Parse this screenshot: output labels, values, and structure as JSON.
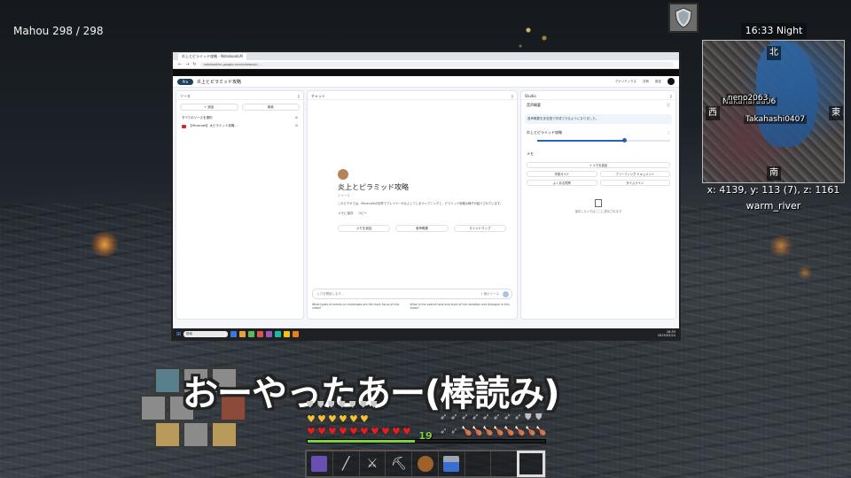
{
  "hud": {
    "player_health": "Mahou 298 / 298"
  },
  "minimap": {
    "time": "16:33 Night",
    "north": "北",
    "south": "南",
    "east": "東",
    "west": "西",
    "player1": "neno2063",
    "player1_hidden": "Nakaharaa06",
    "player2": "Takahashi0407",
    "coords": "x: 4139, y: 113 (7), z: 1161",
    "biome": "warm_river"
  },
  "subtitle": "おーやったあー(棒読み)",
  "xp": {
    "level": "19",
    "progress": 0.45
  },
  "screen": {
    "tab_label": "炎上とピラミッド攻略 - NotebookLM",
    "url": "notebooklm.google.com/notebook/...",
    "logo_label": "Pro",
    "notebook_title": "炎上とピラミッド攻略",
    "top_right": [
      "アナリティクス",
      "共有",
      "設定"
    ],
    "sources_header": "ソース",
    "add_label": "+ 追加",
    "explore_label": "検索",
    "select_all": "すべてのソースを選択",
    "source_item": "【Minecraft】大ピラミッド攻略…",
    "chat_header": "チャット",
    "chat_title": "炎上とピラミッド攻略",
    "chat_subtitle": "1 ソース",
    "chat_summary": "このビデオでは、Minecraftの世界でプレイヤーが炎上してしまうハプニングと、ピラミッド攻略の様子が紹介されています。",
    "chat_actions": [
      "メモに保存",
      "コピー"
    ],
    "suggestions": [
      "メモを追加",
      "音声概要",
      "マインドマップ"
    ],
    "input_placeholder": "入力を開始します…",
    "source_count": "1 個のソース",
    "questions": [
      "What types of events or challenges are the main focus of this video?",
      "What is the overall tone and style of the narration and dialogue in this video?"
    ],
    "studio_header": "Studio",
    "audio_overview": "音声概要",
    "studio_notice": "音声概要を多言語で作成できるようになりました。",
    "audio_item_title": "炎上とピラミッド攻略",
    "audio_progress": 0.65,
    "notes_header": "メモ",
    "add_note": "+ メモを追加",
    "studio_chips": [
      "学習ガイド",
      "ブリーフィング ドキュメント",
      "よくある質問",
      "タイムライン"
    ],
    "notes_empty": "保存したメモはここに表示されます",
    "taskbar_search": "検索",
    "clock_time": "16:33",
    "clock_date": "2025/03/24"
  }
}
